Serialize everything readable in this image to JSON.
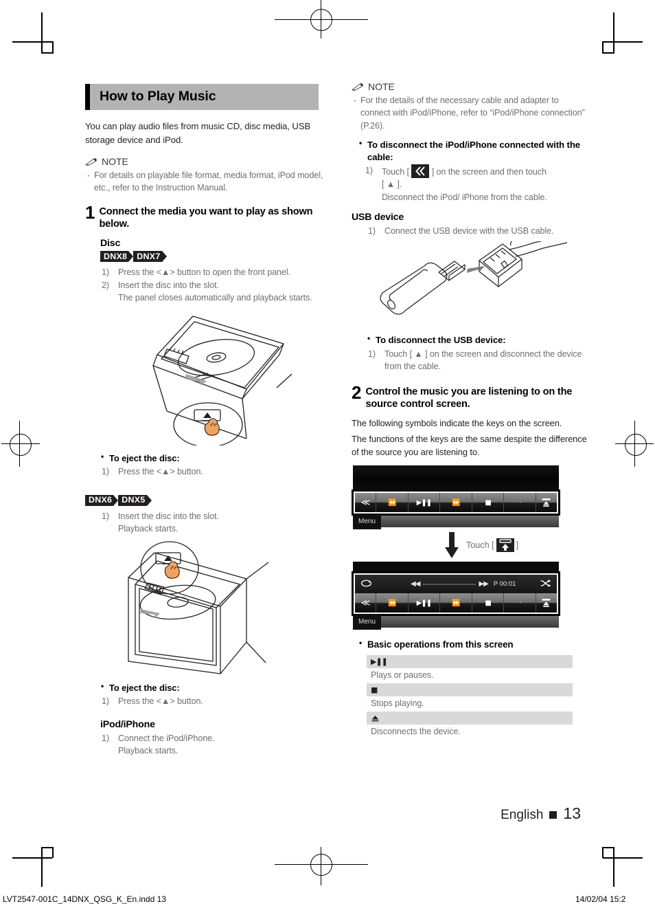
{
  "document": {
    "section_title": "How to Play Music",
    "intro": "You can play audio files from music CD, disc media, USB storage device and iPod.",
    "note_label": "NOTE"
  },
  "left_column": {
    "note_items": [
      "For details on playable file format, media format, iPod model, etc., refer to the Instruction Manual."
    ],
    "step1": {
      "number": "1",
      "text": "Connect the media you want to play as shown below."
    },
    "disc_heading": "Disc",
    "badges_a": [
      "DNX8",
      "DNX7"
    ],
    "disc_steps_a": [
      {
        "marker": "1)",
        "text": "Press the <▲> button to open the front panel."
      },
      {
        "marker": "2)",
        "text": "Insert the disc into the slot.",
        "cont": "The panel closes automatically and playback starts."
      }
    ],
    "eject_a": {
      "title": "To eject the disc:",
      "marker": "1)",
      "text": "Press the <▲> button."
    },
    "badges_b": [
      "DNX6",
      "DNX5"
    ],
    "disc_steps_b": [
      {
        "marker": "1)",
        "text": "Insert the disc into the slot.",
        "cont": "Playback starts."
      }
    ],
    "eject_b": {
      "title": "To eject the disc:",
      "marker": "1)",
      "text": "Press the <▲> button."
    },
    "ipod_heading": "iPod/iPhone",
    "ipod_steps": [
      {
        "marker": "1)",
        "text": "Connect the iPod/iPhone.",
        "cont": "Playback starts."
      }
    ]
  },
  "right_column": {
    "note_label": "NOTE",
    "note_items": [
      "For the details of the necessary cable and adapter to connect with iPod/iPhone, refer to “iPod/iPhone connection” (P.26)."
    ],
    "disconnect_ipod": {
      "title": "To disconnect the iPod/iPhone connected with the cable:",
      "marker": "1)",
      "text_before": "Touch [",
      "icon": "double-chevron-left-icon",
      "text_middle": "] on the screen and then touch",
      "text_bracket": "[ ▲ ].",
      "text_after": "Disconnect the iPod/ iPhone from the cable."
    },
    "usb_heading": "USB device",
    "usb_steps": [
      {
        "marker": "1)",
        "text": "Connect the USB device with the USB cable."
      }
    ],
    "disconnect_usb": {
      "title": "To disconnect the USB device:",
      "marker": "1)",
      "text": "Touch [ ▲ ] on the screen and disconnect the device from the cable."
    },
    "step2": {
      "number": "2",
      "text": "Control the music you are listening to on the source control screen."
    },
    "step2_body": [
      "The following symbols indicate the keys on the screen.",
      "The functions of the keys are the same despite the difference of the source you are listening to."
    ],
    "screens": {
      "menu_label": "Menu",
      "control_keys": [
        "≪",
        "◀◀",
        "▶❙❙",
        "▶▶",
        "■",
        "·",
        "eject-icon"
      ],
      "info_bar": {
        "repeat_icon": "repeat-icon",
        "rewind": "◀◀",
        "forward": "▶▶",
        "time": "P 00:01",
        "shuffle_icon": "shuffle-icon"
      },
      "touch_label_before": "Touch [",
      "touch_icon": "expand-up-icon",
      "touch_label_after": "]"
    },
    "basic_ops_title": "Basic operations from this screen",
    "key_table": [
      {
        "key": "▶❙❙",
        "desc": "Plays or pauses."
      },
      {
        "key": "■",
        "desc": "Stops playing."
      },
      {
        "key": "▲",
        "desc": "Disconnects the device."
      }
    ]
  },
  "footer": {
    "language": "English",
    "page_number": "13",
    "print_left": "LVT2547-001C_14DNX_QSG_K_En.indd   13",
    "print_right": "14/02/04   15:2"
  }
}
